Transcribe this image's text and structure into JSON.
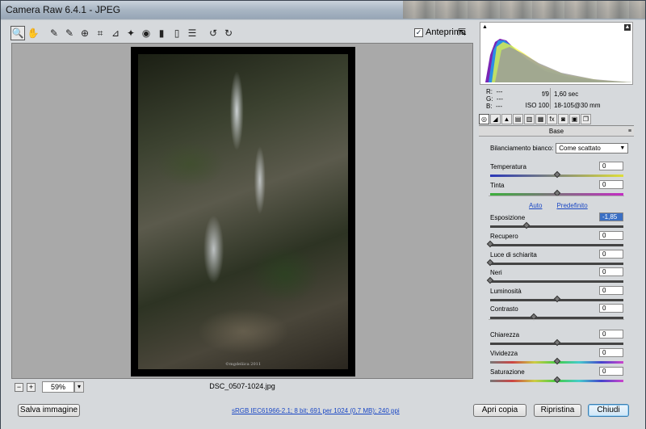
{
  "window": {
    "title": "Camera Raw 6.4.1  -  JPEG"
  },
  "toolbar": {
    "tools": [
      {
        "name": "zoom-tool",
        "glyph": "🔍"
      },
      {
        "name": "hand-tool",
        "glyph": "✋"
      },
      {
        "name": "white-balance-tool",
        "glyph": "✎"
      },
      {
        "name": "color-sampler-tool",
        "glyph": "✎"
      },
      {
        "name": "targeted-adjustment-tool",
        "glyph": "⊕"
      },
      {
        "name": "crop-tool",
        "glyph": "⌗"
      },
      {
        "name": "straighten-tool",
        "glyph": "⊿"
      },
      {
        "name": "spot-removal-tool",
        "glyph": "✦"
      },
      {
        "name": "red-eye-tool",
        "glyph": "◉"
      },
      {
        "name": "adjustment-brush-tool",
        "glyph": "▮"
      },
      {
        "name": "graduated-filter-tool",
        "glyph": "▯"
      },
      {
        "name": "preferences-tool",
        "glyph": "☰"
      },
      {
        "name": "rotate-left-tool",
        "glyph": "↺"
      },
      {
        "name": "rotate-right-tool",
        "glyph": "↻"
      }
    ],
    "preview_label": "Anteprima",
    "preview_checked": "✓"
  },
  "preview": {
    "watermark": "©mgdeliica 2011",
    "zoom_minus": "−",
    "zoom_plus": "+",
    "zoom_value": "59%",
    "zoom_dropdown": "▾",
    "filename": "DSC_0507-1024.jpg"
  },
  "histogram": {
    "shadow_warning": "▲",
    "highlight_warning": "▲"
  },
  "readout": {
    "r_label": "R:",
    "r_value": "---",
    "g_label": "G:",
    "g_value": "---",
    "b_label": "B:",
    "b_value": "---"
  },
  "exif": {
    "aperture": "f/9",
    "shutter": "1,60 sec",
    "iso": "ISO 100",
    "lens": "18-105@30 mm"
  },
  "panel_tabs": [
    {
      "name": "tab-basic",
      "glyph": "◎"
    },
    {
      "name": "tab-tone-curve",
      "glyph": "◢"
    },
    {
      "name": "tab-detail",
      "glyph": "▲"
    },
    {
      "name": "tab-hsl",
      "glyph": "▤"
    },
    {
      "name": "tab-split-toning",
      "glyph": "▥"
    },
    {
      "name": "tab-lens-corrections",
      "glyph": "▦"
    },
    {
      "name": "tab-effects",
      "glyph": "fx"
    },
    {
      "name": "tab-camera-calibration",
      "glyph": "◙"
    },
    {
      "name": "tab-presets",
      "glyph": "▣"
    },
    {
      "name": "tab-snapshots",
      "glyph": "❐"
    }
  ],
  "panel": {
    "title": "Base",
    "menu_glyph": "≡",
    "white_balance_label": "Bilanciamento bianco:",
    "white_balance_value": "Come scattato",
    "auto_label": "Auto",
    "default_label": "Predefinito",
    "sliders": [
      {
        "label": "Temperatura",
        "value": "0",
        "level": 0.5
      },
      {
        "label": "Tinta",
        "value": "0",
        "level": 0.5
      },
      {
        "label": "Esposizione",
        "value": "-1,85",
        "level": 0.27
      },
      {
        "label": "Recupero",
        "value": "0",
        "level": 0.0
      },
      {
        "label": "Luce di schiarita",
        "value": "0",
        "level": 0.0
      },
      {
        "label": "Neri",
        "value": "0",
        "level": 0.0
      },
      {
        "label": "Luminosità",
        "value": "0",
        "level": 0.5
      },
      {
        "label": "Contrasto",
        "value": "0",
        "level": 0.33
      },
      {
        "label": "Chiarezza",
        "value": "0",
        "level": 0.5
      },
      {
        "label": "Vividezza",
        "value": "0",
        "level": 0.5
      },
      {
        "label": "Saturazione",
        "value": "0",
        "level": 0.5
      }
    ]
  },
  "footer": {
    "save_button": "Salva immagine",
    "workflow_link": "sRGB IEC61966-2.1; 8 bit; 691 per 1024 (0,7 MB); 240 ppi",
    "open_copy_button": "Apri copia",
    "reset_button": "Ripristina",
    "close_button": "Chiudi"
  },
  "colors": {
    "accent": "#3a6fc4",
    "link": "#1a47c4"
  }
}
